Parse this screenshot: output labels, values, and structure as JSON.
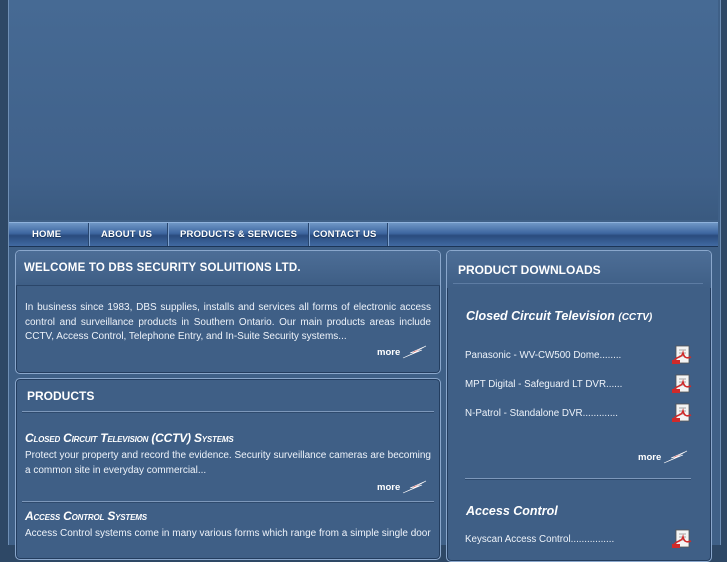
{
  "nav": {
    "home": "Home",
    "about": "About Us",
    "products": "Products & Services",
    "contact": "Contact Us"
  },
  "welcome": {
    "title": "Welcome to DBS Security Soluitions Ltd.",
    "text": "In business since 1983, DBS supplies, installs and services all forms of electronic access control and surveillance products in Southern Ontario. Our main products areas include CCTV, Access Control, Telephone Entry, and In-Suite Security systems...",
    "more": "more"
  },
  "products": {
    "title": "Products",
    "items": [
      {
        "title": "Closed Circuit Television (CCTV) Systems",
        "text": "Protect your property and record the evidence. Security surveillance cameras are becoming a common site in everyday commercial...",
        "more": "more"
      },
      {
        "title": "Access Control Systems",
        "text": "Access Control systems come in many various forms which range from a simple single door"
      }
    ]
  },
  "downloads": {
    "title": "Product Downloads",
    "categories": [
      {
        "name": "Closed Circuit Television",
        "abbr": "(CCTV)",
        "items": [
          "Panasonic - WV-CW500 Dome........",
          "MPT Digital - Safeguard LT DVR......",
          "N-Patrol - Standalone DVR............."
        ],
        "more": "more"
      },
      {
        "name": "Access Control",
        "items": [
          "Keyscan Access Control................"
        ]
      }
    ]
  },
  "colors": {
    "background": "#3f6087",
    "accent": "#e0403a",
    "text": "#ffffff"
  },
  "icons": {
    "more": "red-arrow-icon",
    "download": "pdf-document-icon"
  }
}
